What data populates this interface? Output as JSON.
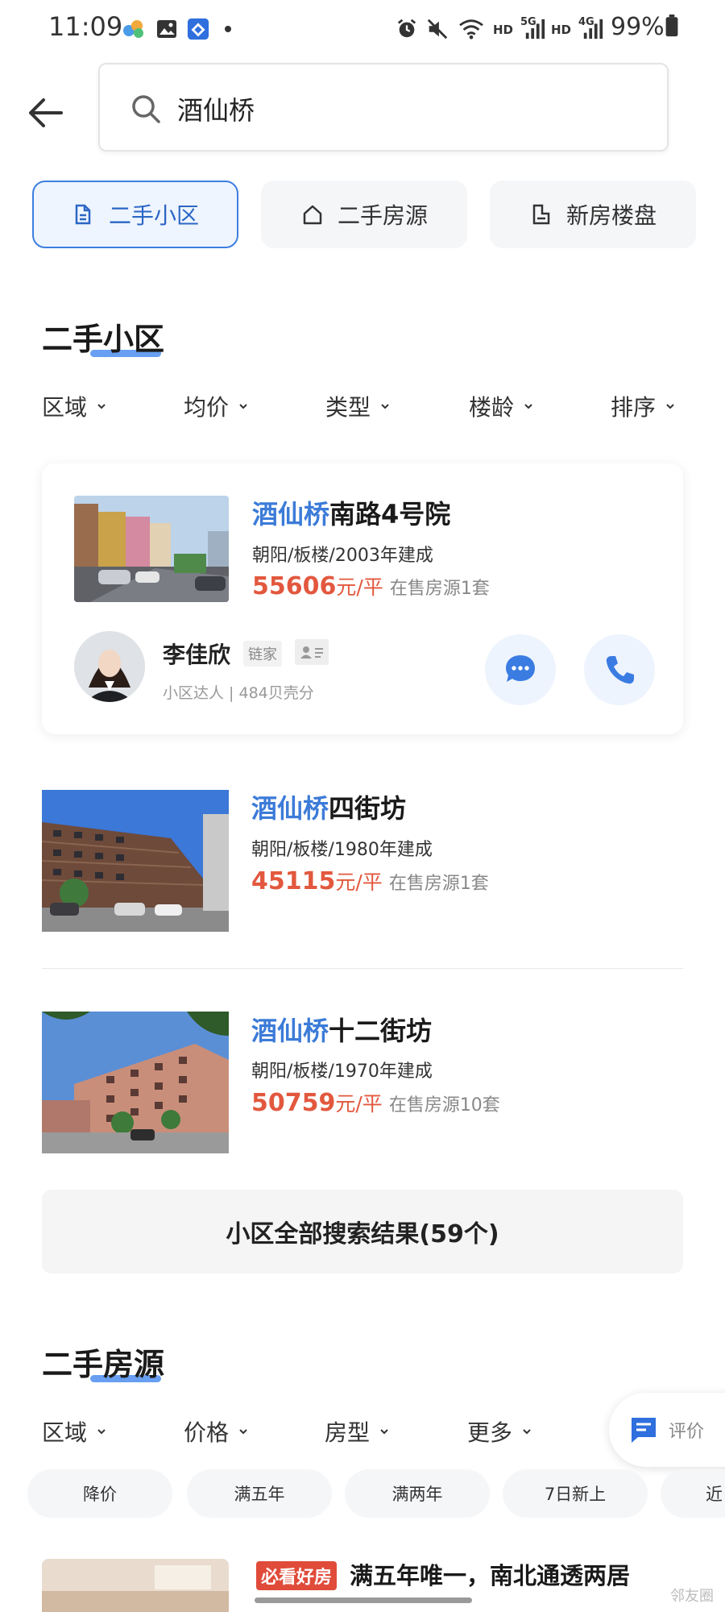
{
  "status_bar": {
    "time": "11:09",
    "battery": "99%",
    "net_hd1": "HD",
    "net_5g": "5G",
    "net_hd2": "HD",
    "net_4g": "4G"
  },
  "search": {
    "query": "酒仙桥"
  },
  "tabs": [
    {
      "label": "二手小区",
      "active": true
    },
    {
      "label": "二手房源",
      "active": false
    },
    {
      "label": "新房楼盘",
      "active": false
    }
  ],
  "community_section": {
    "title": "二手小区",
    "filters": [
      "区域",
      "均价",
      "类型",
      "楼龄",
      "排序"
    ]
  },
  "listings": [
    {
      "highlight": "酒仙桥",
      "name_rest": "南路4号院",
      "meta": "朝阳/板楼/2003年建成",
      "price": "55606",
      "unit": "元/平",
      "count": "在售房源1套"
    },
    {
      "highlight": "酒仙桥",
      "name_rest": "四街坊",
      "meta": "朝阳/板楼/1980年建成",
      "price": "45115",
      "unit": "元/平",
      "count": "在售房源1套"
    },
    {
      "highlight": "酒仙桥",
      "name_rest": "十二街坊",
      "meta": "朝阳/板楼/1970年建成",
      "price": "50759",
      "unit": "元/平",
      "count": "在售房源10套"
    }
  ],
  "agent": {
    "name": "李佳欣",
    "brand": "链家",
    "sub": "小区达人 | 484贝壳分"
  },
  "all_results_label": "小区全部搜索结果(59个)",
  "house_section": {
    "title": "二手房源",
    "filters": [
      "区域",
      "价格",
      "房型",
      "更多"
    ]
  },
  "chips": [
    "降价",
    "满五年",
    "满两年",
    "7日新上",
    "近"
  ],
  "float_button": {
    "label": "评价"
  },
  "bottom_listing": {
    "tag": "必看好房",
    "title": "满五年唯一，南北通透两居"
  },
  "watermark": "邻友圈",
  "colors": {
    "accent": "#3c7bd8",
    "price": "#e2583e",
    "tag": "#e04b3a"
  }
}
